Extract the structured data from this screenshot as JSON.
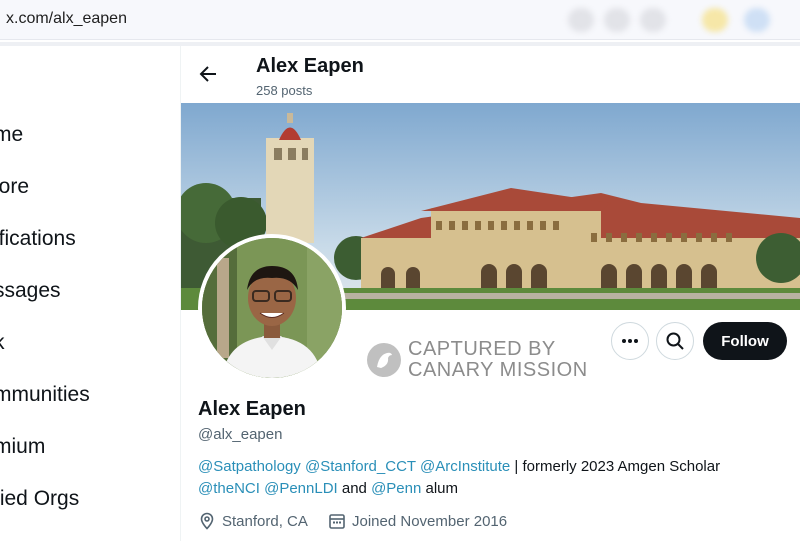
{
  "browser": {
    "url": "x.com/alx_eapen"
  },
  "nav": {
    "items": [
      {
        "label": "me"
      },
      {
        "label": "lore"
      },
      {
        "label": "ifications"
      },
      {
        "label": "ssages"
      },
      {
        "label": "k"
      },
      {
        "label": "mmunities"
      },
      {
        "label": "mium"
      },
      {
        "label": "fied Orgs"
      }
    ]
  },
  "header": {
    "name": "Alex Eapen",
    "posts": "258 posts"
  },
  "watermark": {
    "line1": "CAPTURED BY",
    "line2": "CANARY MISSION"
  },
  "actions": {
    "follow_label": "Follow",
    "more_icon": "more-icon",
    "search_icon": "search-icon"
  },
  "profile": {
    "name": "Alex Eapen",
    "handle": "@alx_eapen",
    "bio_line1": [
      {
        "text": "@Satpathology",
        "link": true
      },
      {
        "text": " ",
        "link": false
      },
      {
        "text": "@Stanford_CCT",
        "link": true
      },
      {
        "text": " ",
        "link": false
      },
      {
        "text": "@ArcInstitute",
        "link": true
      },
      {
        "text": " | formerly 2023 Amgen Scholar",
        "link": false
      }
    ],
    "bio_line2": [
      {
        "text": "@theNCI",
        "link": true
      },
      {
        "text": " ",
        "link": false
      },
      {
        "text": "@PennLDI",
        "link": true
      },
      {
        "text": " and ",
        "link": false
      },
      {
        "text": "@Penn",
        "link": true
      },
      {
        "text": " alum",
        "link": false
      }
    ],
    "location": "Stanford, CA",
    "joined": "Joined November 2016"
  },
  "colors": {
    "link": "#2a8fb8",
    "follow_bg": "#0f1419",
    "muted": "#536471"
  }
}
